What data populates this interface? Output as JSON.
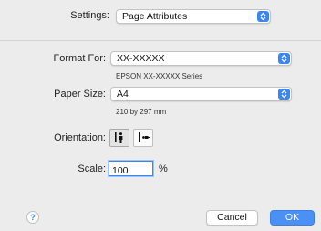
{
  "settings": {
    "label": "Settings:",
    "value": "Page Attributes"
  },
  "format_for": {
    "label": "Format For:",
    "value": "XX-XXXXX",
    "subtext": "EPSON XX-XXXXX Series"
  },
  "paper_size": {
    "label": "Paper Size:",
    "value": "A4",
    "subtext": "210 by 297 mm"
  },
  "orientation": {
    "label": "Orientation:",
    "selected": "portrait"
  },
  "scale": {
    "label": "Scale:",
    "value": "100",
    "unit": "%"
  },
  "footer": {
    "help_label": "?",
    "cancel_label": "Cancel",
    "ok_label": "OK"
  },
  "colors": {
    "accent": "#3b86f5",
    "background": "#ececec"
  },
  "icons": {
    "popup_arrows": "up-down-chevron-icon",
    "portrait": "portrait-orientation-icon",
    "landscape": "landscape-orientation-icon",
    "help": "question-mark-icon"
  }
}
